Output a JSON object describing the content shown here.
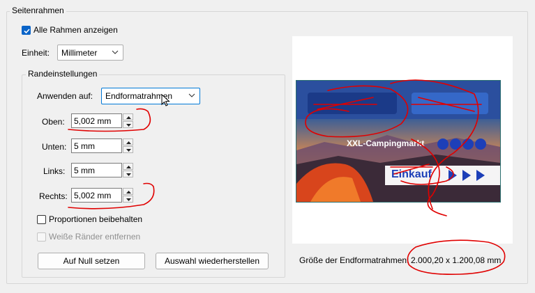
{
  "section_title": "Seitenrahmen",
  "show_all_frames": {
    "label": "Alle Rahmen anzeigen",
    "checked": true
  },
  "unit": {
    "label": "Einheit:",
    "value": "Millimeter"
  },
  "margin_settings": {
    "title": "Randeinstellungen",
    "apply_to": {
      "label": "Anwenden auf:",
      "value": "Endformatrahmen"
    },
    "fields": [
      {
        "label": "Oben:",
        "value": "5,002 mm"
      },
      {
        "label": "Unten:",
        "value": "5 mm"
      },
      {
        "label": "Links:",
        "value": "5 mm"
      },
      {
        "label": "Rechts:",
        "value": "5,002 mm"
      }
    ],
    "keep_proportions": {
      "label": "Proportionen beibehalten",
      "checked": false
    },
    "remove_white_margins": {
      "label": "Weiße Ränder entfernen",
      "checked": false,
      "enabled": false
    },
    "reset_button": "Auf Null setzen",
    "restore_button": "Auswahl wiederherstellen"
  },
  "preview": {
    "banner_title": "XXL-Campingmarkt",
    "banner_cta": "Einkauf"
  },
  "size_info": {
    "label": "Größe der Endformatrahmen:",
    "value": "2.000,20 x 1.200,08 mm"
  },
  "colors": {
    "checkbox_accent": "#0a64c8",
    "annotation_red": "#e00000",
    "banner_top_blue": "#2b4f9e",
    "banner_cta_blue": "#1d3fb8"
  }
}
